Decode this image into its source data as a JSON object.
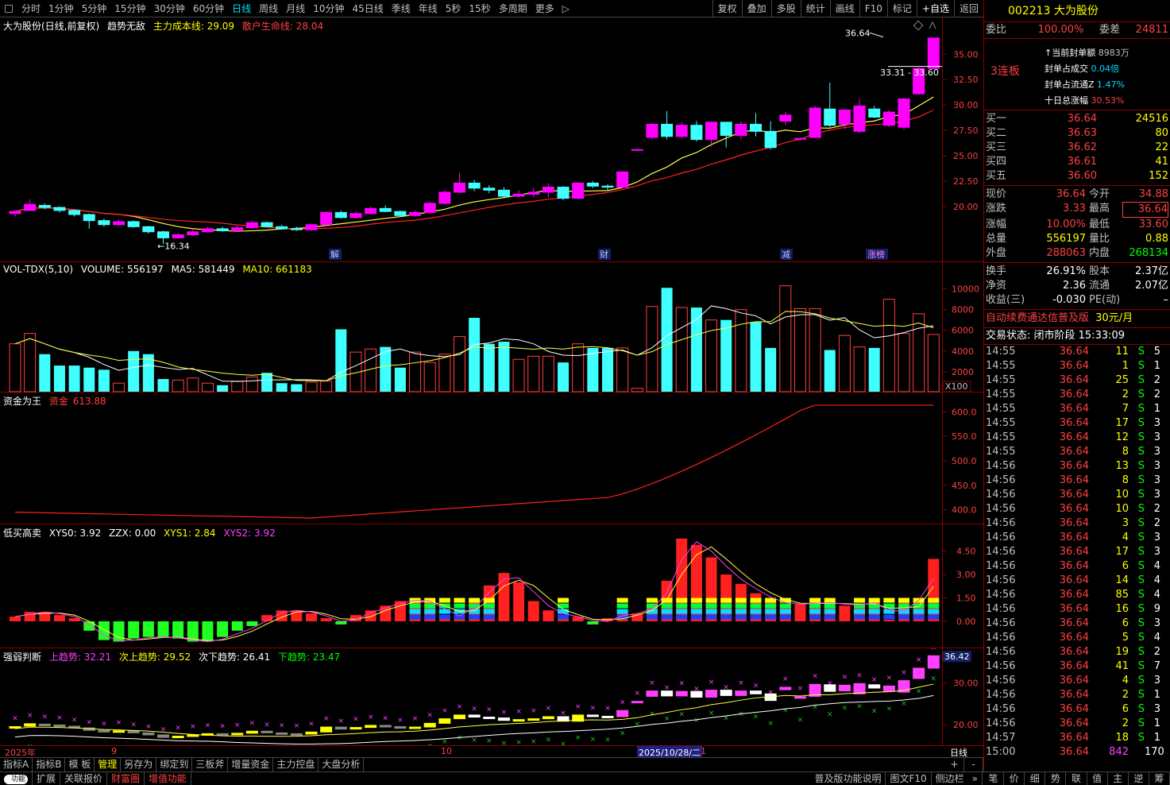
{
  "toolbar": {
    "periods": [
      "分时",
      "1分钟",
      "5分钟",
      "15分钟",
      "30分钟",
      "60分钟",
      "日线",
      "周线",
      "月线",
      "10分钟",
      "45日线",
      "季线",
      "年线",
      "5秒",
      "15秒",
      "多周期",
      "更多"
    ],
    "more_arrow": "▷",
    "active_period": "日线",
    "tools": [
      "复权",
      "叠加",
      "多股",
      "统计",
      "画线",
      "F10",
      "标记",
      "+自选",
      "返回"
    ]
  },
  "kline": {
    "title": "大为股份(日线,前复权)",
    "indicator": "趋势无敌",
    "cost_label": "主力成本线: 29.09",
    "life_label": "散户生命线: 28.04",
    "high_mark": "36.64",
    "low_mark": "16.34",
    "range_label": "33.31 - 33.60",
    "y_ticks": [
      "35.00",
      "32.50",
      "30.00",
      "27.50",
      "25.00",
      "22.50",
      "20.00"
    ],
    "events": [
      "解",
      "财",
      "减",
      "涨榜"
    ],
    "colors": {
      "up": "#ff00ff",
      "down": "#40ffff",
      "ma1": "#ffff40",
      "ma2": "#ff2020"
    }
  },
  "volume": {
    "title": "VOL-TDX(5,10)",
    "volume": "VOLUME: 556197",
    "ma5": "MA5: 581449",
    "ma10": "MA10: 661183",
    "y_ticks": [
      "10000",
      "8000",
      "6000",
      "4000",
      "2000"
    ],
    "unit": "X100"
  },
  "fund": {
    "title": "资金为王",
    "label": "资金",
    "value": "613.88",
    "y_ticks": [
      "600.0",
      "550.0",
      "500.0",
      "450.0",
      "400.0"
    ]
  },
  "lowbuy": {
    "title": "低买高卖",
    "xys0": "XYS0: 3.92",
    "zzx": "ZZX: 0.00",
    "xys1": "XYS1: 2.84",
    "xys2": "XYS2: 3.92",
    "y_ticks": [
      "4.50",
      "3.00",
      "1.50",
      "0.00"
    ]
  },
  "strength": {
    "title": "强弱判断",
    "up": "上趋势: 32.21",
    "sub_up": "次上趋势: 29.52",
    "sub_down": "次下趋势: 26.41",
    "down": "下趋势: 23.47",
    "y_ticks": [
      "30.00",
      "20.00"
    ],
    "last": "36.42"
  },
  "datebar": {
    "labels": [
      "2025年",
      "9",
      "10",
      "2025/10/28/二",
      "1"
    ],
    "right": "日线"
  },
  "tabs_indicator": [
    "指标A",
    "指标B",
    "模 板",
    "管理",
    "另存为",
    "绑定到",
    "三板斧",
    "增量资金",
    "主力控盘",
    "大盘分析"
  ],
  "tabs_bottom": {
    "toggle": "功能",
    "left": [
      "扩展",
      "关联报价",
      "财富圈",
      "增值功能"
    ],
    "right": [
      "普及版功能说明",
      "图文F10",
      "侧边栏"
    ],
    "right_arrow": "»",
    "plusminus": [
      "+",
      "-"
    ]
  },
  "quote": {
    "code_name": "002213 大为股份",
    "weibi_label": "委比",
    "weibi": "100.00%",
    "weicha_label": "委差",
    "weicha": "24811",
    "lianban": "3连板",
    "seal_info": [
      {
        "label": "当前封单额",
        "value": "8983万"
      },
      {
        "label": "封单占成交",
        "value": "0.04倍"
      },
      {
        "label": "封单占流通Z",
        "value": "1.47%"
      },
      {
        "label": "十日总涨幅",
        "value": "30.53%"
      }
    ],
    "buys": [
      {
        "label": "买一",
        "price": "36.64",
        "vol": "24516"
      },
      {
        "label": "买二",
        "price": "36.63",
        "vol": "80"
      },
      {
        "label": "买三",
        "price": "36.62",
        "vol": "22"
      },
      {
        "label": "买四",
        "price": "36.61",
        "vol": "41"
      },
      {
        "label": "买五",
        "price": "36.60",
        "vol": "152"
      }
    ],
    "stats1": [
      {
        "l1": "现价",
        "v1": "36.64",
        "l2": "今开",
        "v2": "34.88"
      },
      {
        "l1": "涨跌",
        "v1": "3.33",
        "l2": "最高",
        "v2": "36.64"
      },
      {
        "l1": "涨幅",
        "v1": "10.00%",
        "l2": "最低",
        "v2": "33.60"
      },
      {
        "l1": "总量",
        "v1": "556197",
        "l2": "量比",
        "v2": "0.88"
      },
      {
        "l1": "外盘",
        "v1": "288063",
        "l2": "内盘",
        "v2": "268134"
      }
    ],
    "stats2": [
      {
        "l1": "换手",
        "v1": "26.91%",
        "l2": "股本",
        "v2": "2.37亿"
      },
      {
        "l1": "净资",
        "v1": "2.36",
        "l2": "流通",
        "v2": "2.07亿"
      },
      {
        "l1": "收益(三)",
        "v1": "-0.030",
        "l2": "PE(动)",
        "v2": "–"
      }
    ],
    "promo": "自动续费通达信普及版",
    "promo_price": "30元/月",
    "status": "交易状态: 闭市阶段 15:33:09"
  },
  "ticks": [
    {
      "t": "14:55",
      "p": "36.64",
      "v": "11",
      "d": "S",
      "n": "5"
    },
    {
      "t": "14:55",
      "p": "36.64",
      "v": "1",
      "d": "S",
      "n": "1"
    },
    {
      "t": "14:55",
      "p": "36.64",
      "v": "25",
      "d": "S",
      "n": "2"
    },
    {
      "t": "14:55",
      "p": "36.64",
      "v": "2",
      "d": "S",
      "n": "2"
    },
    {
      "t": "14:55",
      "p": "36.64",
      "v": "7",
      "d": "S",
      "n": "1"
    },
    {
      "t": "14:55",
      "p": "36.64",
      "v": "17",
      "d": "S",
      "n": "3"
    },
    {
      "t": "14:55",
      "p": "36.64",
      "v": "12",
      "d": "S",
      "n": "3"
    },
    {
      "t": "14:55",
      "p": "36.64",
      "v": "8",
      "d": "S",
      "n": "3"
    },
    {
      "t": "14:56",
      "p": "36.64",
      "v": "13",
      "d": "S",
      "n": "3"
    },
    {
      "t": "14:56",
      "p": "36.64",
      "v": "8",
      "d": "S",
      "n": "3"
    },
    {
      "t": "14:56",
      "p": "36.64",
      "v": "10",
      "d": "S",
      "n": "3"
    },
    {
      "t": "14:56",
      "p": "36.64",
      "v": "10",
      "d": "S",
      "n": "2"
    },
    {
      "t": "14:56",
      "p": "36.64",
      "v": "3",
      "d": "S",
      "n": "2"
    },
    {
      "t": "14:56",
      "p": "36.64",
      "v": "4",
      "d": "S",
      "n": "3"
    },
    {
      "t": "14:56",
      "p": "36.64",
      "v": "17",
      "d": "S",
      "n": "3"
    },
    {
      "t": "14:56",
      "p": "36.64",
      "v": "6",
      "d": "S",
      "n": "4"
    },
    {
      "t": "14:56",
      "p": "36.64",
      "v": "14",
      "d": "S",
      "n": "4"
    },
    {
      "t": "14:56",
      "p": "36.64",
      "v": "85",
      "d": "S",
      "n": "4"
    },
    {
      "t": "14:56",
      "p": "36.64",
      "v": "16",
      "d": "S",
      "n": "9"
    },
    {
      "t": "14:56",
      "p": "36.64",
      "v": "6",
      "d": "S",
      "n": "3"
    },
    {
      "t": "14:56",
      "p": "36.64",
      "v": "5",
      "d": "S",
      "n": "4"
    },
    {
      "t": "14:56",
      "p": "36.64",
      "v": "19",
      "d": "S",
      "n": "2"
    },
    {
      "t": "14:56",
      "p": "36.64",
      "v": "41",
      "d": "S",
      "n": "7"
    },
    {
      "t": "14:56",
      "p": "36.64",
      "v": "4",
      "d": "S",
      "n": "3"
    },
    {
      "t": "14:56",
      "p": "36.64",
      "v": "2",
      "d": "S",
      "n": "1"
    },
    {
      "t": "14:56",
      "p": "36.64",
      "v": "6",
      "d": "S",
      "n": "3"
    },
    {
      "t": "14:56",
      "p": "36.64",
      "v": "2",
      "d": "S",
      "n": "1"
    },
    {
      "t": "14:57",
      "p": "36.64",
      "v": "18",
      "d": "S",
      "n": "1"
    },
    {
      "t": "15:00",
      "p": "36.64",
      "v": "842",
      "d": "",
      "n": "170"
    }
  ],
  "side_icons": [
    "笔",
    "价",
    "细",
    "势",
    "联",
    "值",
    "主",
    "逆",
    "筹"
  ],
  "chart_data": {
    "type": "candlestick",
    "candles": [
      [
        19.3,
        19.5,
        19.0,
        19.6
      ],
      [
        19.6,
        20.2,
        19.5,
        20.7
      ],
      [
        20.1,
        19.9,
        19.7,
        20.3
      ],
      [
        19.9,
        19.6,
        19.4,
        20.0
      ],
      [
        19.6,
        19.2,
        19.0,
        19.7
      ],
      [
        19.2,
        18.6,
        17.8,
        19.3
      ],
      [
        18.6,
        18.2,
        18.0,
        18.8
      ],
      [
        18.2,
        18.5,
        18.1,
        18.7
      ],
      [
        18.5,
        18.0,
        17.9,
        18.6
      ],
      [
        18.0,
        17.5,
        17.3,
        18.1
      ],
      [
        17.5,
        16.9,
        16.3,
        17.6
      ],
      [
        16.9,
        17.2,
        16.8,
        17.4
      ],
      [
        17.2,
        17.5,
        17.1,
        17.7
      ],
      [
        17.5,
        17.8,
        17.4,
        18.0
      ],
      [
        17.8,
        17.6,
        17.5,
        18.0
      ],
      [
        17.6,
        17.9,
        17.5,
        18.1
      ],
      [
        17.9,
        18.4,
        17.8,
        18.6
      ],
      [
        18.4,
        18.0,
        17.9,
        18.5
      ],
      [
        18.0,
        17.8,
        17.7,
        18.2
      ],
      [
        17.8,
        17.7,
        17.6,
        18.0
      ],
      [
        17.7,
        18.2,
        17.6,
        18.3
      ],
      [
        18.2,
        19.4,
        18.1,
        19.5
      ],
      [
        19.4,
        18.9,
        18.8,
        19.6
      ],
      [
        18.9,
        19.3,
        18.8,
        19.5
      ],
      [
        19.3,
        19.8,
        19.2,
        20.0
      ],
      [
        19.8,
        19.5,
        19.4,
        20.1
      ],
      [
        19.5,
        19.1,
        19.0,
        19.6
      ],
      [
        19.1,
        19.4,
        19.0,
        19.6
      ],
      [
        19.4,
        20.3,
        19.3,
        20.5
      ],
      [
        20.3,
        21.4,
        20.2,
        21.6
      ],
      [
        21.4,
        22.3,
        21.3,
        23.3
      ],
      [
        22.3,
        21.8,
        21.5,
        22.6
      ],
      [
        21.8,
        21.6,
        21.3,
        22.1
      ],
      [
        21.6,
        21.0,
        20.9,
        21.9
      ],
      [
        21.0,
        21.2,
        20.9,
        21.6
      ],
      [
        21.2,
        21.4,
        20.9,
        21.8
      ],
      [
        21.4,
        21.9,
        20.9,
        22.3
      ],
      [
        21.9,
        20.8,
        20.6,
        22.0
      ],
      [
        20.8,
        22.3,
        20.7,
        22.4
      ],
      [
        22.3,
        22.0,
        21.8,
        22.5
      ],
      [
        22.0,
        21.9,
        21.6,
        22.2
      ],
      [
        21.9,
        23.4,
        21.8,
        23.5
      ],
      [
        25.6,
        25.6,
        25.5,
        25.7
      ],
      [
        26.8,
        28.1,
        26.6,
        28.2
      ],
      [
        28.1,
        26.9,
        26.6,
        29.4
      ],
      [
        26.9,
        28.0,
        26.7,
        28.3
      ],
      [
        28.0,
        26.6,
        26.4,
        28.4
      ],
      [
        26.6,
        28.3,
        25.9,
        28.4
      ],
      [
        28.3,
        27.0,
        25.8,
        28.3
      ],
      [
        27.0,
        28.1,
        26.6,
        28.4
      ],
      [
        28.1,
        27.4,
        26.9,
        29.2
      ],
      [
        27.4,
        25.8,
        25.6,
        28.4
      ],
      [
        28.4,
        29.0,
        28.0,
        29.3
      ],
      [
        26.7,
        26.7,
        26.5,
        26.8
      ],
      [
        26.8,
        29.7,
        26.7,
        29.9
      ],
      [
        29.6,
        28.0,
        27.8,
        32.2
      ],
      [
        28.1,
        29.5,
        27.6,
        29.6
      ],
      [
        27.4,
        29.9,
        27.2,
        30.6
      ],
      [
        29.6,
        28.8,
        28.7,
        29.9
      ],
      [
        28.0,
        29.3,
        27.8,
        29.5
      ],
      [
        27.8,
        30.6,
        27.6,
        30.7
      ],
      [
        31.1,
        33.6,
        31.0,
        33.7
      ],
      [
        33.6,
        36.6,
        33.6,
        36.6
      ]
    ]
  }
}
